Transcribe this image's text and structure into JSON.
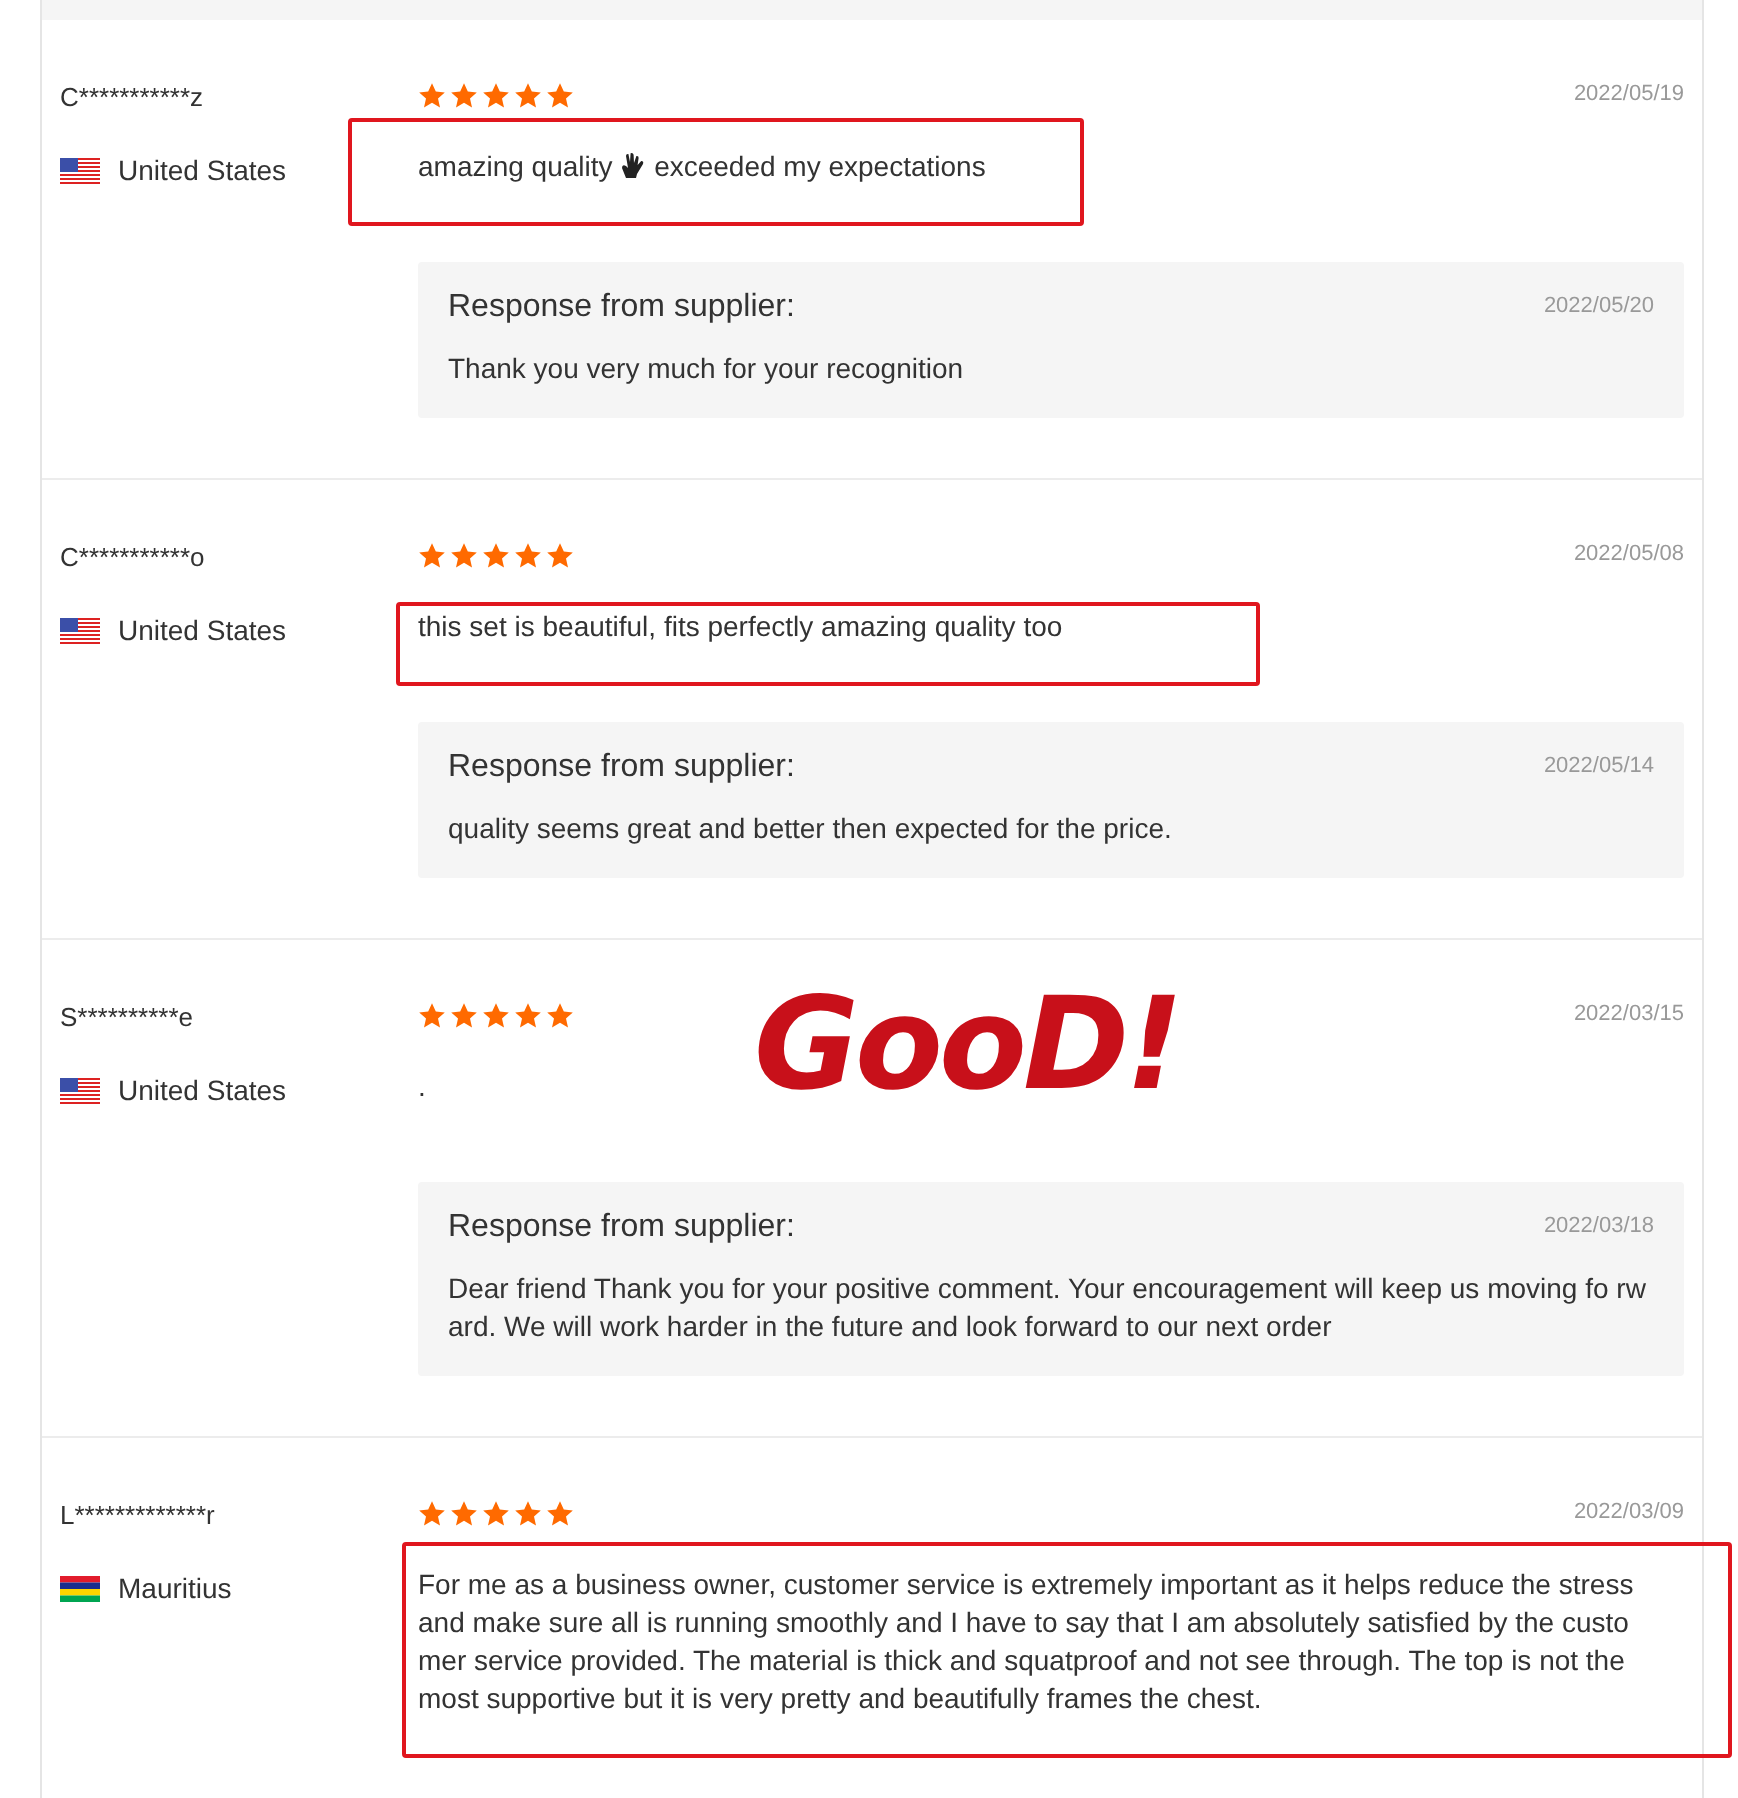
{
  "reviews": [
    {
      "name": "C***********z",
      "country": "United States",
      "kind": "us",
      "stars": 5,
      "date": "2022/05/19",
      "comment_parts": [
        {
          "kind": "text",
          "text": "amazing quality"
        },
        {
          "kind": "hand_icon"
        },
        {
          "kind": "text",
          "text": "exceeded my expectations"
        }
      ],
      "highlighted": true,
      "response": {
        "title": "Response from supplier:",
        "date": "2022/05/20",
        "text": "Thank you very much for your recognition"
      }
    },
    {
      "name": "C***********o",
      "country": "United States",
      "kind": "us",
      "stars": 5,
      "date": "2022/05/08",
      "comment_parts": [
        {
          "kind": "text",
          "text": "this set is beautiful, fits perfectly amazing quality too"
        }
      ],
      "highlighted": true,
      "response": {
        "title": "Response from supplier:",
        "date": "2022/05/14",
        "text": "quality seems great and better then expected for the price."
      }
    },
    {
      "name": "S**********e",
      "country": "United States",
      "kind": "us",
      "stars": 5,
      "date": "2022/03/15",
      "comment_parts": [
        {
          "kind": "text",
          "text": "."
        }
      ],
      "highlighted": false,
      "sticker": "GooD!",
      "response": {
        "title": "Response from supplier:",
        "date": "2022/03/18",
        "text": "Dear friend Thank you for your positive comment. Your encouragement will keep us moving fo rward. We will work harder in the future and look forward to our next order"
      }
    },
    {
      "name": "L*************r",
      "country": "Mauritius",
      "kind": "mu",
      "stars": 5,
      "date": "2022/03/09",
      "comment_parts": [
        {
          "kind": "text",
          "text": "For me as a business owner, customer service is extremely important as it helps reduce the stress and make sure all is running smoothly and I have to say that I am absolutely satisfied by the custo mer service provided. The material is thick and squatproof and not see through. The top is not the most supportive but it is very pretty and beautifully frames the chest."
        }
      ],
      "highlighted": true
    }
  ]
}
